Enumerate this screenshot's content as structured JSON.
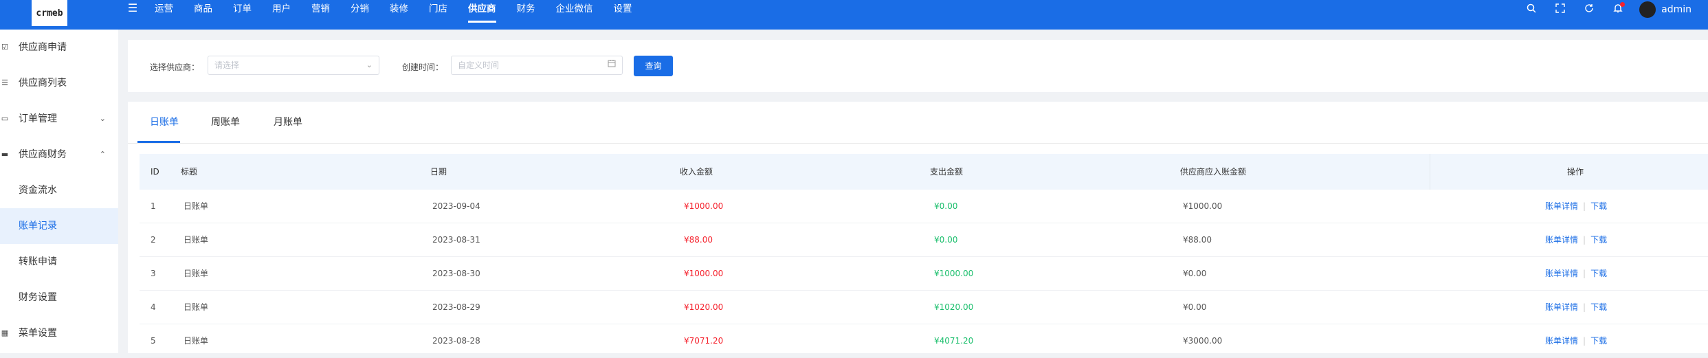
{
  "logo": {
    "text": "crmeb"
  },
  "top_nav": [
    {
      "label": "运营"
    },
    {
      "label": "商品"
    },
    {
      "label": "订单"
    },
    {
      "label": "用户"
    },
    {
      "label": "营销"
    },
    {
      "label": "分销"
    },
    {
      "label": "装修"
    },
    {
      "label": "门店"
    },
    {
      "label": "供应商",
      "active": true
    },
    {
      "label": "财务"
    },
    {
      "label": "企业微信"
    },
    {
      "label": "设置"
    }
  ],
  "header": {
    "username": "admin",
    "accent_color": "#1a6de6"
  },
  "icons": {
    "menu": "menu-fold-icon",
    "search": "search-icon",
    "fullscreen": "fullscreen-icon",
    "refresh": "refresh-icon",
    "bell": "bell-icon"
  },
  "sidebar": {
    "items": [
      {
        "label": "供应商申请",
        "icon": "checkbox-icon"
      },
      {
        "label": "供应商列表",
        "icon": "list-icon"
      },
      {
        "label": "订单管理",
        "icon": "order-icon",
        "caret": "down"
      },
      {
        "label": "供应商财务",
        "icon": "finance-icon",
        "caret": "up"
      },
      {
        "label": "资金流水",
        "sub": true
      },
      {
        "label": "账单记录",
        "sub": true,
        "active": true
      },
      {
        "label": "转账申请",
        "sub": true
      },
      {
        "label": "财务设置",
        "sub": true
      },
      {
        "label": "菜单设置",
        "icon": "grid-icon"
      }
    ]
  },
  "filter": {
    "supplier_label": "选择供应商：",
    "supplier_placeholder": "请选择",
    "time_label": "创建时间：",
    "time_placeholder": "自定义时间",
    "search_button": "查询"
  },
  "tabs": [
    {
      "label": "日账单",
      "active": true
    },
    {
      "label": "周账单"
    },
    {
      "label": "月账单"
    }
  ],
  "table": {
    "columns": {
      "id": "ID",
      "title": "标题",
      "date": "日期",
      "income": "收入金额",
      "expense": "支出金额",
      "settle": "供应商应入账金额",
      "ops": "操作"
    },
    "rows": [
      {
        "id": "1",
        "title": "日账单",
        "date": "2023-09-04",
        "income": "¥1000.00",
        "expense": "¥0.00",
        "settle": "¥1000.00"
      },
      {
        "id": "2",
        "title": "日账单",
        "date": "2023-08-31",
        "income": "¥88.00",
        "expense": "¥0.00",
        "settle": "¥88.00"
      },
      {
        "id": "3",
        "title": "日账单",
        "date": "2023-08-30",
        "income": "¥1000.00",
        "expense": "¥1000.00",
        "settle": "¥0.00"
      },
      {
        "id": "4",
        "title": "日账单",
        "date": "2023-08-29",
        "income": "¥1020.00",
        "expense": "¥1020.00",
        "settle": "¥0.00"
      },
      {
        "id": "5",
        "title": "日账单",
        "date": "2023-08-28",
        "income": "¥7071.20",
        "expense": "¥4071.20",
        "settle": "¥3000.00"
      }
    ],
    "actions": {
      "detail": "账单详情",
      "download": "下载"
    }
  }
}
